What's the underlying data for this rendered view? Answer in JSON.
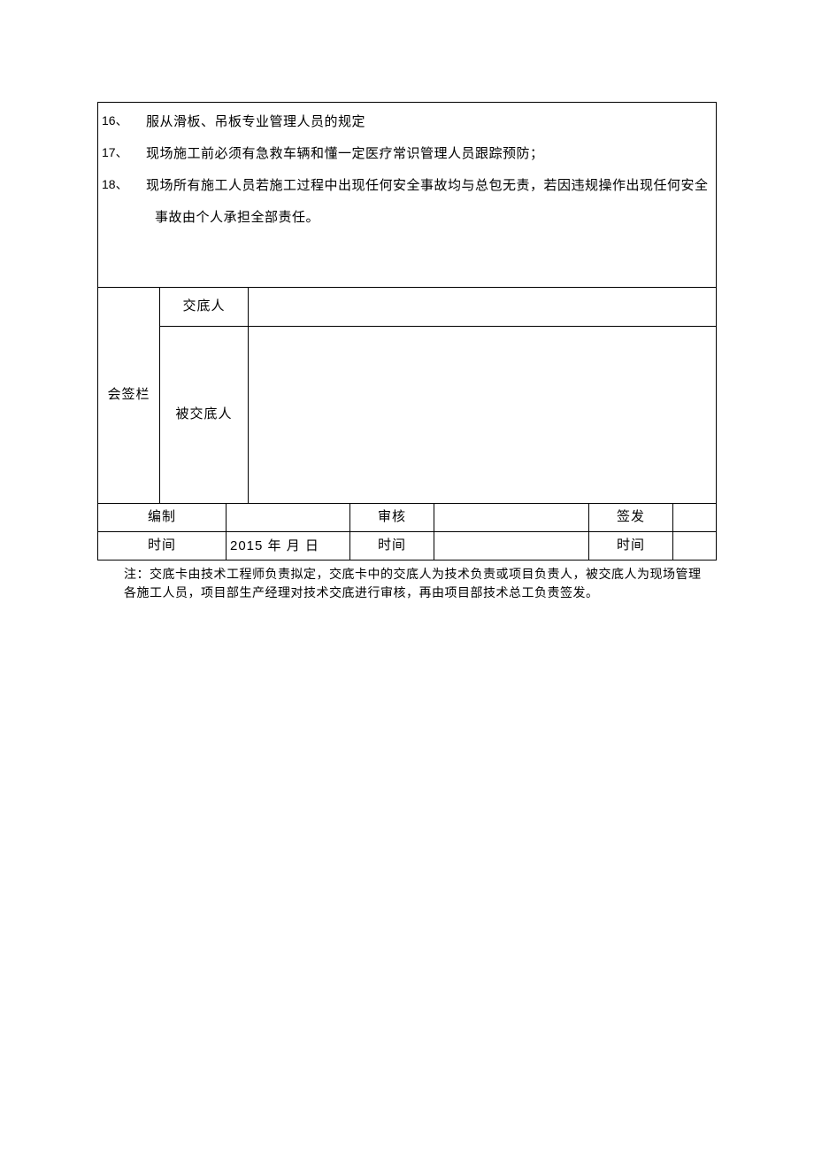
{
  "content": {
    "items": [
      {
        "num": "16、",
        "text": "服从滑板、吊板专业管理人员的规定"
      },
      {
        "num": "17、",
        "text": "现场施工前必须有急救车辆和懂一定医疗常识管理人员跟踪预防；"
      },
      {
        "num": "18、",
        "text": "现场所有施工人员若施工过程中出现任何安全事故均与总包无责，若因违规操作出现任何安全"
      }
    ],
    "cont": "事故由个人承担全部责任。"
  },
  "sign": {
    "huiqian": "会签栏",
    "jiaodiren": "交底人",
    "beijiaodiren": "被交底人"
  },
  "footer": {
    "bianzhi": "编制",
    "shenhe": "审核",
    "qianfa": "签发",
    "shijian": "时间",
    "date": "2015 年 月 日"
  },
  "note": "注：交底卡由技术工程师负责拟定，交底卡中的交底人为技术负责或项目负责人，被交底人为现场管理各施工人员，项目部生产经理对技术交底进行审核，再由项目部技术总工负责签发。"
}
